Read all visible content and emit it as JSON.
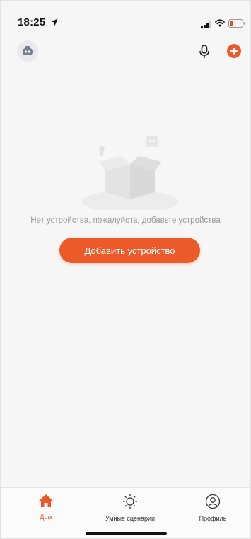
{
  "status_bar": {
    "time": "18:25",
    "icons": [
      "location-arrow-icon",
      "cellular-signal-icon",
      "wifi-icon",
      "battery-low-icon"
    ]
  },
  "header": {
    "avatar_icon": "robot-avatar-icon",
    "mic_icon": "microphone-icon",
    "add_icon": "plus-icon"
  },
  "empty_state": {
    "illustration_icon": "empty-box-icon",
    "message": "Нет устройства, пожалуйста, добавьте устройства",
    "button_label": "Добавить устройство"
  },
  "tab_bar": {
    "tabs": [
      {
        "label": "Дом",
        "icon": "home-icon",
        "active": true
      },
      {
        "label": "Умные сценарии",
        "icon": "sun-icon",
        "active": false
      },
      {
        "label": "Профиль",
        "icon": "user-circle-icon",
        "active": false
      }
    ]
  },
  "colors": {
    "accent": "#ec5a2a",
    "background": "#f6f6f6",
    "muted_text": "#9a9a9a"
  }
}
